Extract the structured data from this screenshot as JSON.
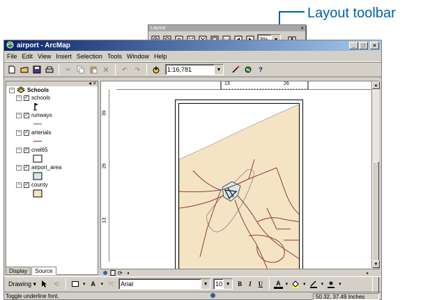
{
  "callout": {
    "label": "Layout toolbar"
  },
  "layout_toolbar": {
    "title": "Layout",
    "zoom": "3%",
    "close_glyph": "×",
    "buttons": [
      "zoom-in-icon",
      "zoom-out-icon",
      "pan-icon",
      "fixed-zoom-in-icon",
      "fixed-zoom-out-icon",
      "zoom-whole-page-icon",
      "zoom-100-icon",
      "go-back-extent-icon",
      "go-forward-extent-icon",
      "toggle-draft-mode-icon"
    ]
  },
  "window": {
    "title": "airport - ArcMap",
    "controls": [
      "_",
      "□",
      "×"
    ]
  },
  "menu": [
    "File",
    "Edit",
    "View",
    "Insert",
    "Selection",
    "Tools",
    "Window",
    "Help"
  ],
  "standard_toolbar": {
    "scale": "1:16,781"
  },
  "toc": {
    "group": "Schools",
    "layers": [
      {
        "name": "schools",
        "checked": true,
        "symbol": "school-marker-icon"
      },
      {
        "name": "runways",
        "checked": true,
        "symbol": "line-symbol"
      },
      {
        "name": "arterials",
        "checked": true,
        "symbol": "line-symbol"
      },
      {
        "name": "cnel65",
        "checked": true,
        "symbol": "polygon-symbol"
      },
      {
        "name": "airport_area",
        "checked": true,
        "symbol": "polygon-symbol"
      },
      {
        "name": "county",
        "checked": true,
        "symbol": "polygon-symbol"
      }
    ],
    "colors": {
      "arterials": "#b03030",
      "runways": "#505050",
      "cnel65": "#ffffff",
      "airport_area": "#d6e8f0",
      "county": "#f5e4c3"
    },
    "tabs": [
      "Display",
      "Source"
    ]
  },
  "rulers": {
    "h_ticks": [
      "13",
      "26"
    ],
    "v_ticks": [
      "39",
      "26",
      "13"
    ]
  },
  "draw_toolbar": {
    "drawing_label": "Drawing",
    "font": "Arial",
    "size": "10",
    "bold": "B",
    "italic": "I",
    "underline": "U",
    "font_color": "A"
  },
  "status": {
    "message": "Toggle underline font.",
    "coords": "50.32, 37.49 Inches"
  },
  "map_colors": {
    "land": "#f5e4c3",
    "roads": "#8b3a3a"
  }
}
